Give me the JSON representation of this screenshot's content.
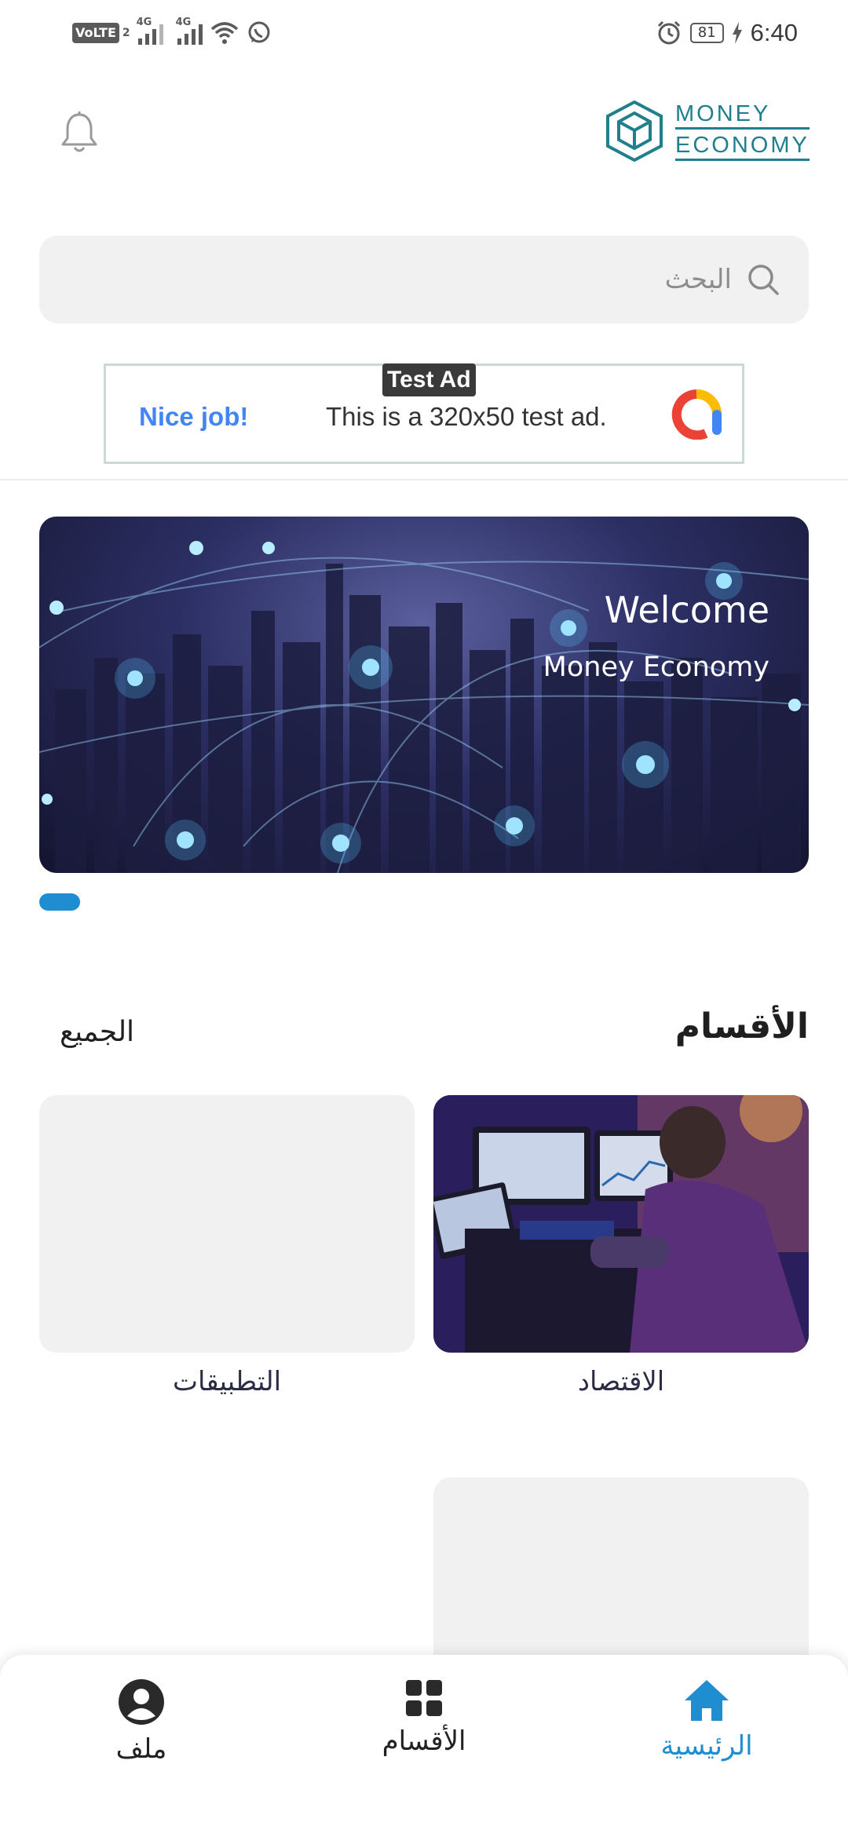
{
  "status_bar": {
    "volte": "VoLTE",
    "sim2": "2",
    "net1": "4G",
    "net2": "4G",
    "battery": "81",
    "time": "6:40"
  },
  "header": {
    "logo_line1": "MONEY",
    "logo_line2": "ECONOMY",
    "brand_color": "#1f7f8c"
  },
  "search": {
    "placeholder": "البحث"
  },
  "ad": {
    "tag": "Test Ad",
    "headline": "Nice job!",
    "text": "This is a 320x50 test ad."
  },
  "banner": {
    "title": "Welcome",
    "subtitle": "Money Economy"
  },
  "sections": {
    "title": "الأقسام",
    "all_link": "الجميع",
    "items": [
      {
        "label": "الاقتصاد"
      },
      {
        "label": "التطبيقات"
      }
    ]
  },
  "bottom_nav": {
    "active_color": "#1f8ed1",
    "items": [
      {
        "label": "الرئيسية",
        "icon": "home-icon"
      },
      {
        "label": "الأقسام",
        "icon": "grid-icon"
      },
      {
        "label": "ملف",
        "icon": "profile-icon"
      }
    ]
  }
}
